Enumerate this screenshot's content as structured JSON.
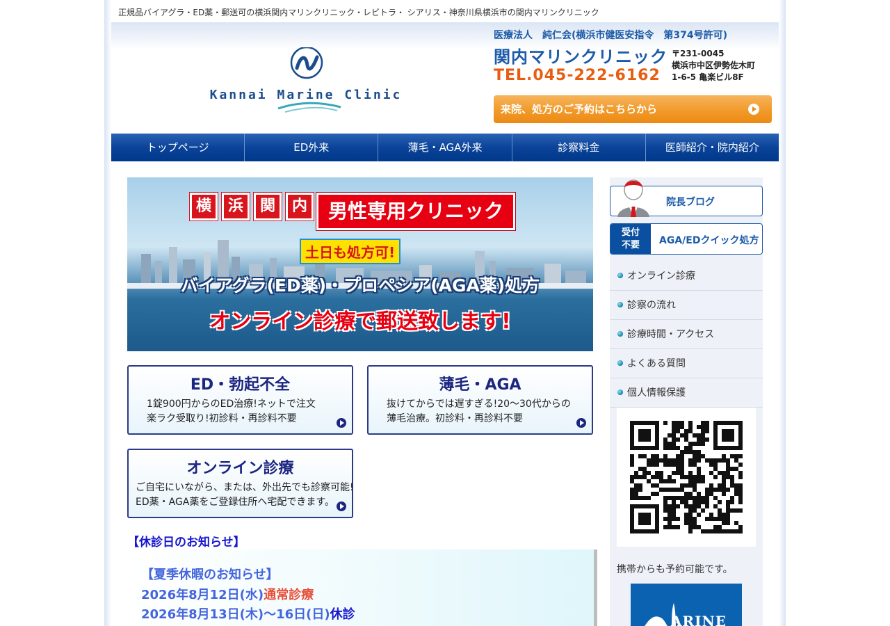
{
  "header": {
    "tagline": "正規品バイアグラ・ED薬・郵送可の横浜関内マリンクリニック・レビトラ・ シアリス・神奈川県横浜市の関内マリンクリニック",
    "logo_text": "Kannai Marine Clinic",
    "corporation": "医療法人　純仁会(横浜市健医安指令　第374号許可)",
    "clinic_name": "関内マリンクリニック",
    "tel": "TEL.045-222-6162",
    "address": [
      "〒231-0045",
      "横浜市中区伊勢佐木町",
      "1-6-5 亀楽ビル8F"
    ],
    "reserve_label": "来院、処方のご予約はこちらから"
  },
  "nav": {
    "items": [
      {
        "label": "トップページ"
      },
      {
        "label": "ED外来"
      },
      {
        "label": "薄毛・AGA外来"
      },
      {
        "label": "診察料金"
      },
      {
        "label": "医師紹介・院内紹介"
      }
    ]
  },
  "hero": {
    "tags": [
      "横",
      "浜",
      "関",
      "内"
    ],
    "title": "男性専用クリニック",
    "weekend": "土日も処方可!",
    "line1": "バイアグラ(ED薬)・プロペシア(AGA薬)処方",
    "line2": "オンライン診療で郵送致します!"
  },
  "cards": [
    {
      "title": "ED・勃起不全",
      "desc1": "1錠900円からのED治療!ネットで注文",
      "desc2": "楽ラク受取り!初診料・再診料不要"
    },
    {
      "title": "薄毛・AGA",
      "desc1": "抜けてからでは遅すぎる!20～30代からの",
      "desc2": "薄毛治療。初診料・再診料不要"
    },
    {
      "title": "オンライン診療",
      "desc1": "ご自宅にいながら、または、外出先でも診察可能!",
      "desc2": "ED薬・AGA薬をご登録住所へ宅配できます。"
    }
  ],
  "notice": {
    "heading": "【休診日のお知らせ】",
    "summer_title": "【夏季休暇のお知らせ】",
    "line1_date": "2026年8月12日(水)",
    "line1_status": "通常診療",
    "line2_date": "2026年8月13日(木)～16日(日)",
    "line2_status": "休診"
  },
  "sidebar": {
    "blog_label": "院長ブログ",
    "quick_left": [
      "受付",
      "不要"
    ],
    "quick_right": "AGA/EDクイック処方",
    "items": [
      {
        "label": "オンライン診療"
      },
      {
        "label": "診察の流れ"
      },
      {
        "label": "診療時間・アクセス"
      },
      {
        "label": "よくある質問"
      },
      {
        "label": "個人情報保護"
      }
    ],
    "mobile_note": "携帯からも予約可能です。",
    "marine_logo_text": "ARINE"
  },
  "colors": {
    "brand_blue": "#1c5ba8",
    "nav_blue": "#0a4398",
    "accent_orange": "#f19a2a",
    "tel_orange": "#e85d12",
    "hero_red": "#e60012"
  }
}
